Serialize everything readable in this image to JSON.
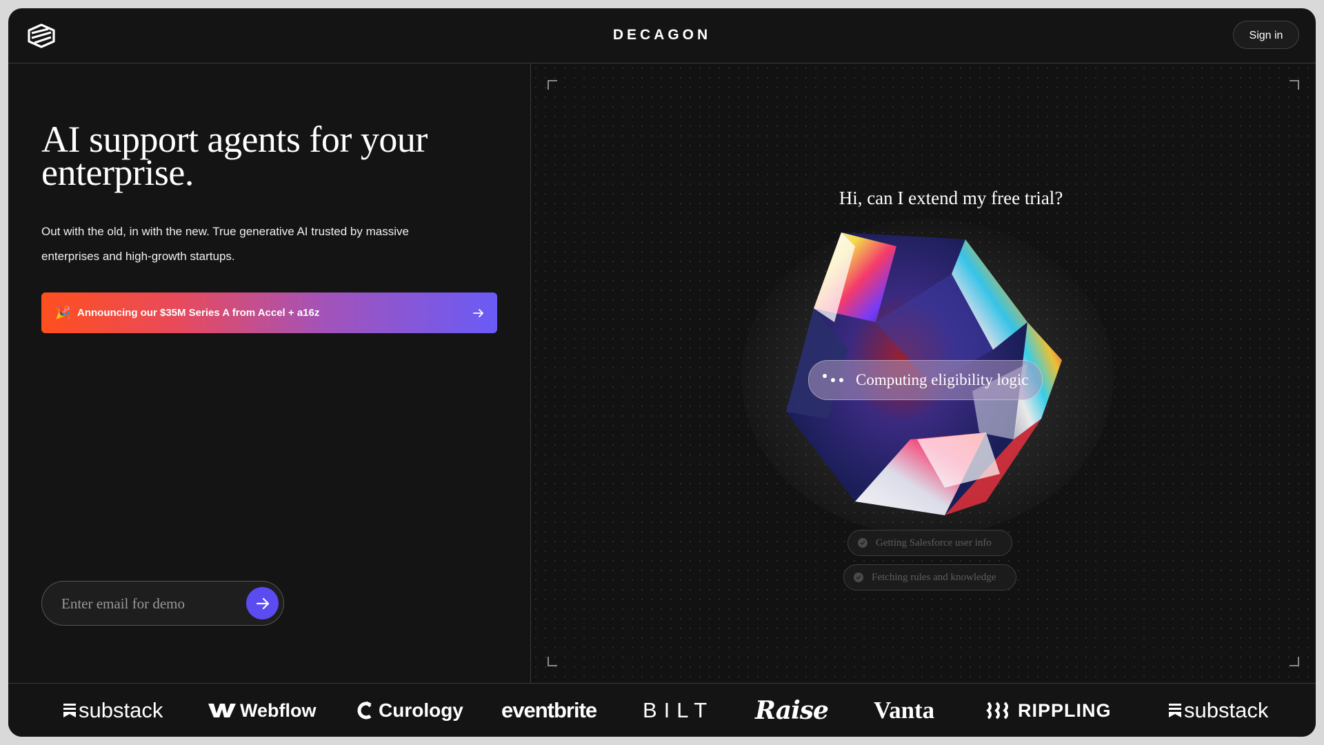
{
  "header": {
    "brand": "DECAGON",
    "signin_label": "Sign in"
  },
  "hero": {
    "title": "AI support agents for your enterprise.",
    "subtitle": "Out with the old, in with the new. True generative AI trusted by massive enterprises and high-growth startups.",
    "announcement": {
      "icon": "🎉",
      "label": "Announcing our $35M Series A from Accel + a16z"
    },
    "email": {
      "placeholder": "Enter email for demo",
      "value": ""
    }
  },
  "demo": {
    "question": "Hi, can I extend my free trial?",
    "status": "Computing eligibility logic",
    "steps": [
      {
        "label": "Getting Salesforce user info"
      },
      {
        "label": "Fetching rules and knowledge"
      }
    ]
  },
  "customers": [
    {
      "name": "substack"
    },
    {
      "name": "Webflow"
    },
    {
      "name": "Curology"
    },
    {
      "name": "eventbrite"
    },
    {
      "name": "BILT"
    },
    {
      "name": "Raise"
    },
    {
      "name": "Vanta"
    },
    {
      "name": "RIPPLING"
    },
    {
      "name": "substack"
    }
  ],
  "colors": {
    "background": "#141414",
    "accent": "#5a4cf0",
    "gradient_start": "#ff4f1f",
    "gradient_end": "#6a5bf6"
  }
}
